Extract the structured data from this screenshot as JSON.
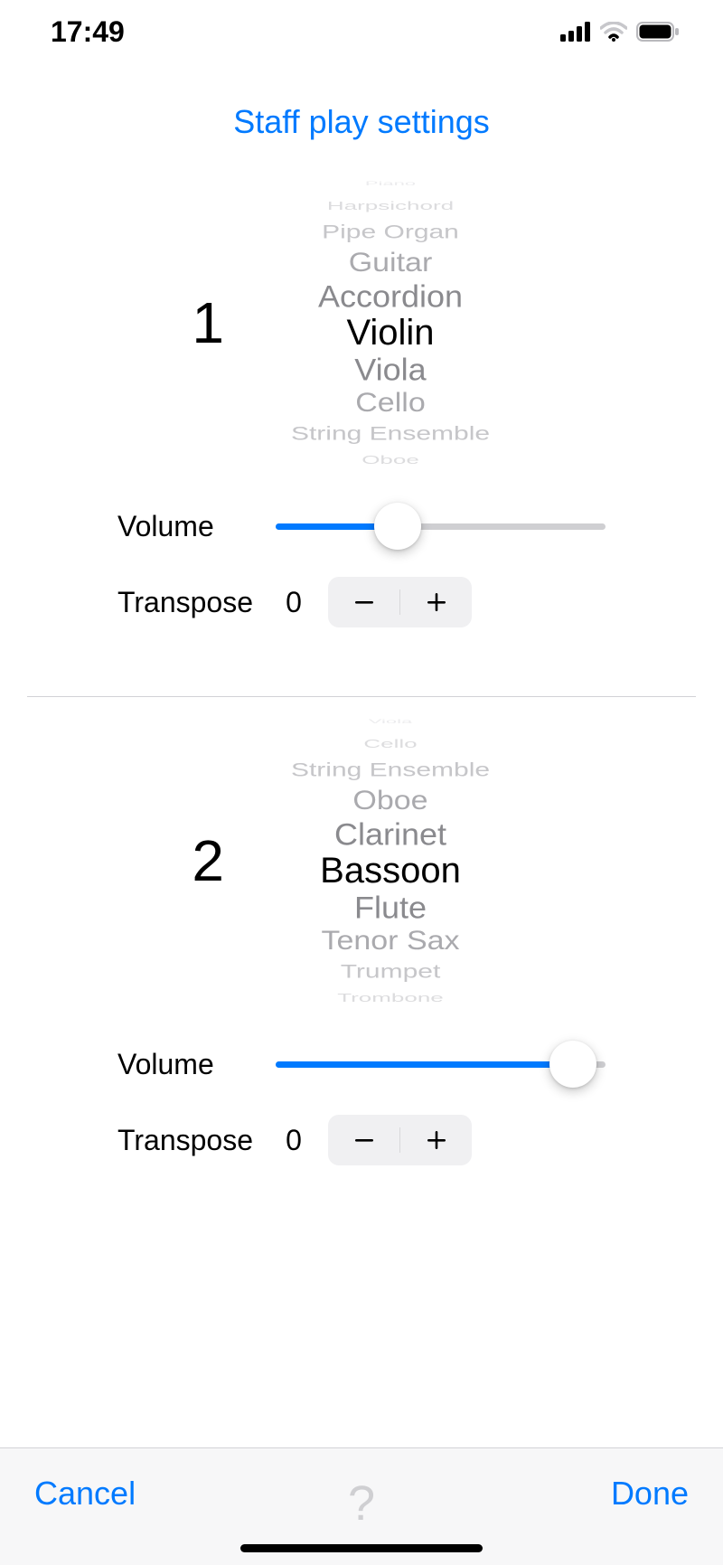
{
  "status_bar": {
    "time": "17:49"
  },
  "title": "Staff play settings",
  "labels": {
    "volume": "Volume",
    "transpose": "Transpose"
  },
  "staffs": [
    {
      "number": "1",
      "picker": {
        "selected": "Violin",
        "above": [
          "Piano",
          "Harpsichord",
          "Pipe Organ",
          "Guitar",
          "Accordion"
        ],
        "below": [
          "Viola",
          "Cello",
          "String Ensemble",
          "Oboe"
        ]
      },
      "volume_percent": 37,
      "transpose": "0"
    },
    {
      "number": "2",
      "picker": {
        "selected": "Bassoon",
        "above": [
          "Viola",
          "Cello",
          "String Ensemble",
          "Oboe",
          "Clarinet"
        ],
        "below": [
          "Flute",
          "Tenor Sax",
          "Trumpet",
          "Trombone"
        ]
      },
      "volume_percent": 90,
      "transpose": "0"
    }
  ],
  "toolbar": {
    "cancel": "Cancel",
    "done": "Done",
    "help": "?"
  },
  "colors": {
    "accent": "#007aff"
  }
}
